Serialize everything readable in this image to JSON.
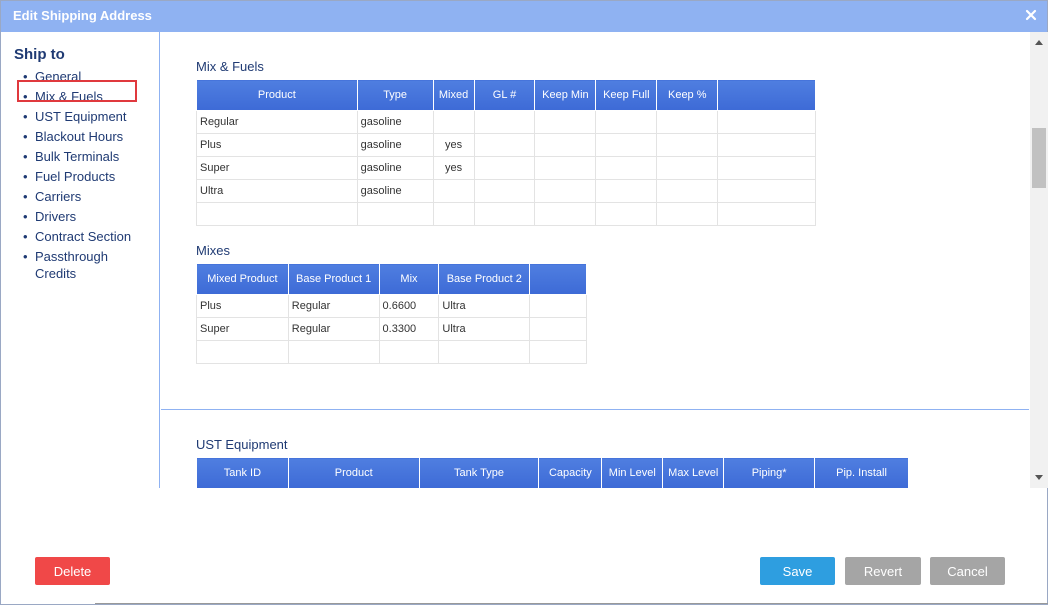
{
  "window": {
    "title": "Edit Shipping Address"
  },
  "sidebar": {
    "heading": "Ship to",
    "items": [
      {
        "label": "General"
      },
      {
        "label": "Mix & Fuels"
      },
      {
        "label": "UST Equipment"
      },
      {
        "label": "Blackout Hours"
      },
      {
        "label": "Bulk Terminals"
      },
      {
        "label": "Fuel Products"
      },
      {
        "label": "Carriers"
      },
      {
        "label": "Drivers"
      },
      {
        "label": "Contract Section"
      },
      {
        "label": "Passthrough Credits"
      }
    ],
    "selected": "Mix & Fuels"
  },
  "mix_fuels": {
    "title": "Mix & Fuels",
    "columns": [
      "Product",
      "Type",
      "Mixed",
      "GL #",
      "Keep Min",
      "Keep Full",
      "Keep %",
      ""
    ],
    "rows": [
      [
        "Regular",
        "gasoline",
        "",
        "",
        "",
        "",
        "",
        ""
      ],
      [
        "Plus",
        "gasoline",
        "yes",
        "",
        "",
        "",
        "",
        ""
      ],
      [
        "Super",
        "gasoline",
        "yes",
        "",
        "",
        "",
        "",
        ""
      ],
      [
        "Ultra",
        "gasoline",
        "",
        "",
        "",
        "",
        "",
        ""
      ],
      [
        "",
        "",
        "",
        "",
        "",
        "",
        "",
        ""
      ]
    ]
  },
  "mixes": {
    "title": "Mixes",
    "columns": [
      "Mixed Product",
      "Base Product 1",
      "Mix",
      "Base Product 2",
      ""
    ],
    "rows": [
      [
        "Plus",
        "Regular",
        "0.6600",
        "Ultra",
        ""
      ],
      [
        "Super",
        "Regular",
        "0.3300",
        "Ultra",
        ""
      ],
      [
        "",
        "",
        "",
        "",
        ""
      ]
    ]
  },
  "ust_equipment": {
    "title": "UST Equipment",
    "columns": [
      "Tank ID",
      "Product",
      "Tank Type",
      "Capacity",
      "Min Level",
      "Max Level",
      "Piping*",
      "Pip. Install"
    ]
  },
  "footer": {
    "delete_label": "Delete",
    "save_label": "Save",
    "revert_label": "Revert",
    "cancel_label": "Cancel"
  },
  "colors": {
    "titlebar": "#8fb2f2",
    "header": "#3d6ad6",
    "delete": "#f04848",
    "save": "#2e9ee0",
    "neutral": "#a5a5a5",
    "selection_box": "#e0393e"
  }
}
